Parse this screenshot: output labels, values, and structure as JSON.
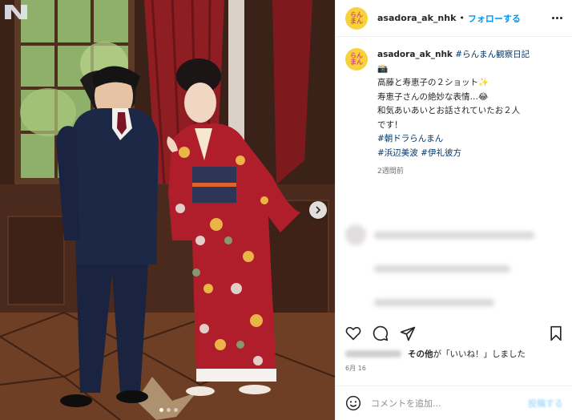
{
  "post": {
    "username": "asadora_ak_nhk",
    "separator": "•",
    "follow_label": "フォローする",
    "avatar_text": "らん\nまん"
  },
  "caption": {
    "username": "asadora_ak_nhk",
    "hashtag_title": "#らんまん観察日記",
    "title_emoji": "📸",
    "line1": "高藤と寿恵子の２ショット✨",
    "line2": "寿恵子さんの絶妙な表情…😂",
    "line3": "和気あいあいとお話されていたお２人",
    "line4": "です！",
    "tag1": "#朝ドラらんまん",
    "tag2": "#浜辺美波",
    "tag3": "#伊礼彼方",
    "time_ago": "2週間前"
  },
  "likes": {
    "suffix_bold": "その他",
    "suffix_text": "が「いいね！」しました"
  },
  "date": "6月 16",
  "comment": {
    "placeholder": "コメントを追加...",
    "post_label": "投稿する"
  },
  "photo": {
    "logo_text": "N",
    "alt": "carousel-photo"
  },
  "colors": {
    "accent": "#0095f6",
    "hashtag": "#00376b",
    "avatar_bg": "#f7d23b",
    "kimono": "#b01e2c"
  }
}
